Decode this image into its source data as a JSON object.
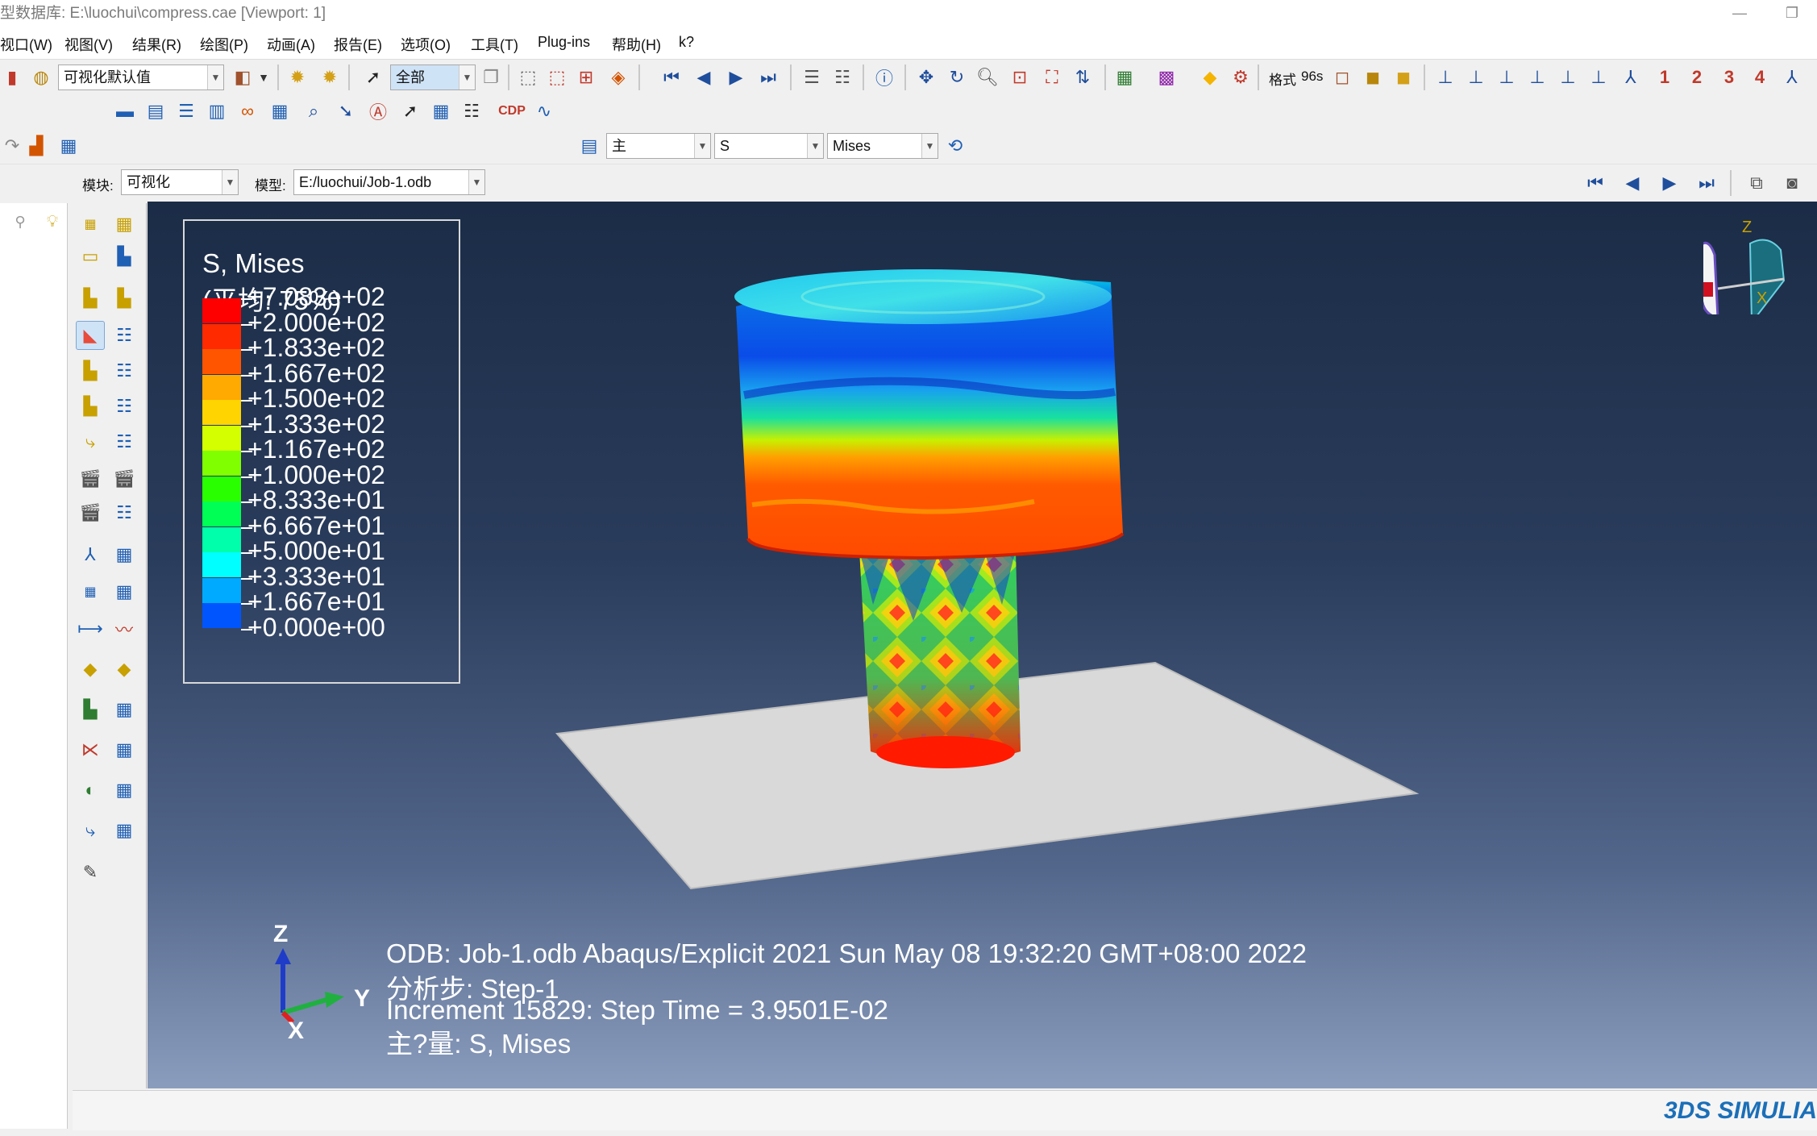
{
  "window": {
    "title": "型数据库: E:\\luochui\\compress.cae [Viewport: 1]",
    "minimize_icon": "minimize-icon",
    "restore_icon": "restore-icon"
  },
  "menu": [
    "视口(W)",
    "视图(V)",
    "结果(R)",
    "绘图(P)",
    "动画(A)",
    "报告(E)",
    "选项(O)",
    "工具(T)",
    "Plug-ins",
    "帮助(H)",
    "k?"
  ],
  "toolbar": {
    "render_style": "可视化默认值",
    "selection_filter": "全部",
    "format_label": "格式",
    "format_value": "96s",
    "view_numbers": [
      "1",
      "2",
      "3",
      "4"
    ],
    "field_primary": "主",
    "field_variable": "S",
    "field_invariant": "Mises"
  },
  "context": {
    "module_label": "模块:",
    "module_value": "可视化",
    "model_label": "模型:",
    "model_value": "E:/luochui/Job-1.odb"
  },
  "legend": {
    "title": "S, Mises",
    "subtitle": "(平均: 75%)",
    "colors": [
      "#ff0000",
      "#ff2a00",
      "#ff5500",
      "#ffaa00",
      "#ffd400",
      "#d4ff00",
      "#80ff00",
      "#2aff00",
      "#00ff55",
      "#00ffaa",
      "#00ffff",
      "#00aaff",
      "#0055ff",
      "#0000ff"
    ],
    "values": [
      "+7.083e+02",
      "+2.000e+02",
      "+1.833e+02",
      "+1.667e+02",
      "+1.500e+02",
      "+1.333e+02",
      "+1.167e+02",
      "+1.000e+02",
      "+8.333e+01",
      "+6.667e+01",
      "+5.000e+01",
      "+3.333e+01",
      "+1.667e+01",
      "+0.000e+00"
    ]
  },
  "triad": {
    "z": "Z",
    "y": "Y",
    "x": "X"
  },
  "info": {
    "line1": "ODB: Job-1.odb    Abaqus/Explicit 2021    Sun May 08 19:32:20 GMT+08:00 2022",
    "line2": "分析步: Step-1",
    "line3": "Increment     15829: Step Time =    3.9501E-02",
    "line4": "主?量: S, Mises"
  },
  "view_cube": {
    "z": "Z",
    "x": "X"
  },
  "brand": "3DS SIMULIA"
}
